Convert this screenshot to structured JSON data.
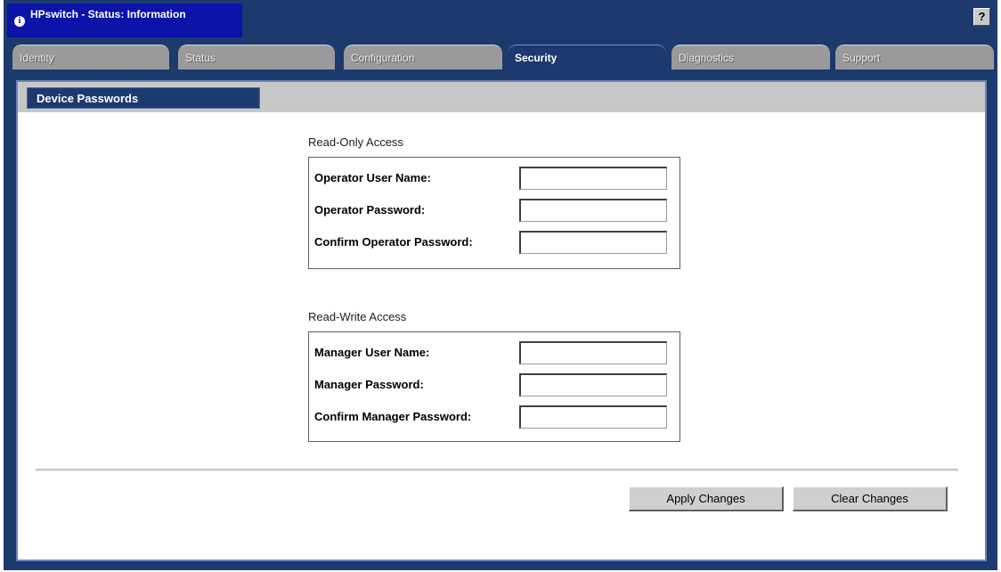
{
  "window": {
    "title": "HPswitch - Status: Information",
    "help_label": "?"
  },
  "tabs": [
    {
      "label": "Identity"
    },
    {
      "label": "Status"
    },
    {
      "label": "Configuration"
    },
    {
      "label": "Security",
      "active": true
    },
    {
      "label": "Diagnostics"
    },
    {
      "label": "Support"
    }
  ],
  "section": {
    "title": "Device Passwords"
  },
  "read_only": {
    "label": "Read-Only Access",
    "fields": [
      {
        "label": "Operator User Name:",
        "value": ""
      },
      {
        "label": "Operator Password:",
        "value": ""
      },
      {
        "label": "Confirm Operator Password:",
        "value": ""
      }
    ]
  },
  "read_write": {
    "label": "Read-Write Access",
    "fields": [
      {
        "label": "Manager User Name:",
        "value": ""
      },
      {
        "label": "Manager Password:",
        "value": ""
      },
      {
        "label": "Confirm Manager Password:",
        "value": ""
      }
    ]
  },
  "buttons": {
    "apply": "Apply Changes",
    "clear": "Clear Changes"
  },
  "colors": {
    "frame": "#1c3a6e",
    "title_box": "#0b13a8",
    "tab_inactive": "#9a9a9a",
    "section_bar": "#c7c7c7"
  },
  "icons": {
    "title": "info-icon",
    "help": "help-icon"
  }
}
